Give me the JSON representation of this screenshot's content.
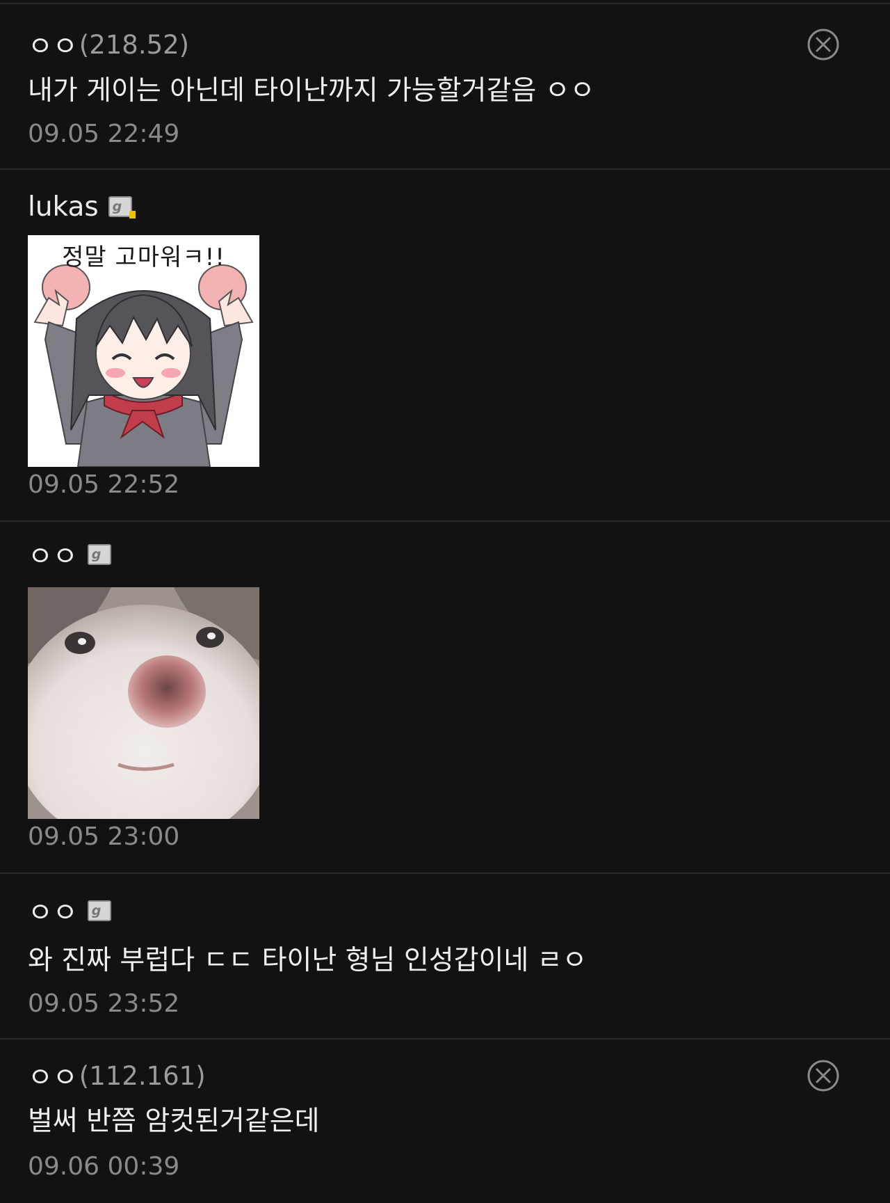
{
  "comments": [
    {
      "author": "ㅇㅇ",
      "ip": "(218.52)",
      "text": "내가 게이는 아닌데 타이난까지 가능할거같음 ㅇㅇ",
      "time": "09.05 22:49",
      "deletable": true
    },
    {
      "author": "lukas",
      "member_icon": "fixed-nick-icon",
      "sticker": "thank-you-anime-girl-sticker",
      "sticker_caption": "정말 고마워ㅋ!!",
      "time": "09.05 22:52"
    },
    {
      "author": "ㅇㅇ",
      "member_icon": "half-fixed-nick-icon",
      "sticker": "cat-face-closeup",
      "time": "09.05 23:00"
    },
    {
      "author": "ㅇㅇ",
      "member_icon": "half-fixed-nick-icon",
      "text": "와 진짜 부럽다 ㄷㄷ 타이난 형님 인성갑이네 ㄹㅇ",
      "time": "09.05 23:52"
    },
    {
      "author": "ㅇㅇ",
      "ip": "(112.161)",
      "text": "벌써 반쯤 암컷된거같은데",
      "time": "09.06 00:39",
      "deletable": true
    }
  ],
  "icons": {
    "delete": "close-circle-icon",
    "member": "gallery-nick-icon"
  },
  "colors": {
    "background": "#121212",
    "divider": "#2a2a2a",
    "text": "#ededed",
    "meta": "#8a8a8a",
    "fixed_nick_badge": "#e6c200"
  }
}
